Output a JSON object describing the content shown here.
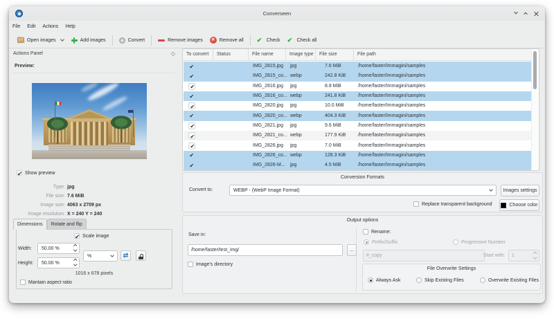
{
  "window": {
    "title": "Converseen"
  },
  "menubar": {
    "items": [
      "File",
      "Edit",
      "Actions",
      "Help"
    ]
  },
  "toolbar": {
    "items": [
      {
        "label": "Open images",
        "icon": "open-folder-icon",
        "dropdown": true,
        "sep": false
      },
      {
        "label": "Add images",
        "icon": "add-icon",
        "dropdown": false,
        "sep": true
      },
      {
        "label": "Convert",
        "icon": "convert-icon",
        "dropdown": false,
        "sep": true
      },
      {
        "label": "Remove images",
        "icon": "remove-icon",
        "dropdown": false,
        "sep": false
      },
      {
        "label": "Remove all",
        "icon": "remove-all-icon",
        "dropdown": false,
        "sep": true
      },
      {
        "label": "Check",
        "icon": "check-icon",
        "dropdown": false,
        "sep": false
      },
      {
        "label": "Check all",
        "icon": "check-all-icon",
        "dropdown": false,
        "sep": false
      }
    ]
  },
  "dock": {
    "title": "Actions Panel",
    "preview_label": "Preview:",
    "show_preview": "Show preview",
    "info": [
      {
        "label": "Type:",
        "value": "jpg"
      },
      {
        "label": "File size:",
        "value": "7.6 MiB"
      },
      {
        "label": "Image size:",
        "value": "4063 x 2709 px"
      },
      {
        "label": "Image resolution:",
        "value": "X = 240 Y = 240"
      }
    ],
    "tabs": [
      "Dimensions",
      "Rotate and flip"
    ],
    "scale_image": "Scale image",
    "width_label": "Width:",
    "width_value": "50.00 %",
    "height_label": "Height:",
    "height_value": "50.00 %",
    "unit": "%",
    "pixels": "1016 x 678 pixels",
    "maintain": "Mantain aspect ratio"
  },
  "table": {
    "columns": [
      "To convert",
      "Status",
      "File name",
      "Image type",
      "File size",
      "File path"
    ],
    "rows": [
      {
        "checked": true,
        "status": "",
        "name": "IMG_2815.jpg",
        "type": "jpg",
        "size": "7.6 MiB",
        "path": "/home/faster/Immagini/samples",
        "selected": true
      },
      {
        "checked": true,
        "status": "",
        "name": "IMG_2815_co...",
        "type": "webp",
        "size": "242.8 KiB",
        "path": "/home/faster/Immagini/samples",
        "selected": true
      },
      {
        "checked": true,
        "status": "",
        "name": "IMG_2816.jpg",
        "type": "jpg",
        "size": "8.8 MiB",
        "path": "/home/faster/Immagini/samples",
        "selected": false
      },
      {
        "checked": true,
        "status": "",
        "name": "IMG_2816_co...",
        "type": "webp",
        "size": "241.8 KiB",
        "path": "/home/faster/Immagini/samples",
        "selected": true
      },
      {
        "checked": true,
        "status": "",
        "name": "IMG_2820.jpg",
        "type": "jpg",
        "size": "10.0 MiB",
        "path": "/home/faster/Immagini/samples",
        "selected": false
      },
      {
        "checked": true,
        "status": "",
        "name": "IMG_2820_co...",
        "type": "webp",
        "size": "404.3 KiB",
        "path": "/home/faster/Immagini/samples",
        "selected": true
      },
      {
        "checked": true,
        "status": "",
        "name": "IMG_2821.jpg",
        "type": "jpg",
        "size": "9.6 MiB",
        "path": "/home/faster/Immagini/samples",
        "selected": false
      },
      {
        "checked": true,
        "status": "",
        "name": "IMG_2821_co...",
        "type": "webp",
        "size": "177.9 KiB",
        "path": "/home/faster/Immagini/samples",
        "selected": false
      },
      {
        "checked": true,
        "status": "",
        "name": "IMG_2826.jpg",
        "type": "jpg",
        "size": "7.0 MiB",
        "path": "/home/faster/Immagini/samples",
        "selected": false
      },
      {
        "checked": true,
        "status": "",
        "name": "IMG_2826_co...",
        "type": "webp",
        "size": "128.3 KiB",
        "path": "/home/faster/Immagini/samples",
        "selected": true
      },
      {
        "checked": true,
        "status": "",
        "name": "IMG_2826-M...",
        "type": "jpg",
        "size": "4.5 MiB",
        "path": "/home/faster/Immagini/samples",
        "selected": true
      }
    ]
  },
  "conversion": {
    "title": "Conversion Formats",
    "convert_to_label": "Convert to:",
    "format": "WEBP - (WebP Image Format)",
    "images_settings": "Images settings",
    "replace_bg": "Replace transparent background",
    "choose_color": "Choose color",
    "color": "#000000"
  },
  "output": {
    "title": "Output options",
    "save_in_label": "Save in:",
    "save_path": "/home/faster/test_img/",
    "browse": "...",
    "images_directory": "Image's directory",
    "rename": "Rename:",
    "prefix_suffix": "Prefix/Suffix",
    "progressive": "Progressive Number",
    "rename_placeholder": "#_copy",
    "start_with": "Start with:",
    "start_value": "1",
    "overwrite": {
      "title": "File Overwrite Settings",
      "options": [
        "Always Ask",
        "Skip Existing Files",
        "Overwrite Existing Files"
      ],
      "selected": 0
    }
  }
}
